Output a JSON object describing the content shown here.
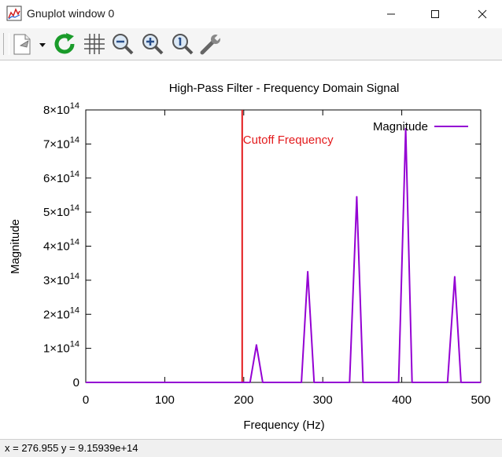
{
  "window": {
    "title": "Gnuplot window 0"
  },
  "toolbar": {
    "buttons": [
      {
        "name": "copy-export-icon"
      },
      {
        "name": "dropdown-arrow-icon"
      },
      {
        "name": "replot-icon"
      },
      {
        "name": "grid-icon"
      },
      {
        "name": "zoom-out-icon"
      },
      {
        "name": "zoom-in-icon"
      },
      {
        "name": "zoom-reset-icon"
      },
      {
        "name": "options-wrench-icon"
      }
    ]
  },
  "status": {
    "text": "x = 276.955 y = 9.15939e+14"
  },
  "colors": {
    "series": "#9400d3",
    "cutoff": "#e31a1c",
    "replot": "#1a9b2a"
  },
  "chart_data": {
    "type": "line",
    "title": "High-Pass Filter - Frequency Domain Signal",
    "xlabel": "Frequency (Hz)",
    "ylabel": "Magnitude",
    "xlim": [
      0,
      500
    ],
    "ylim": [
      0,
      800000000000000.0
    ],
    "x_ticks": [
      "0",
      "100",
      "200",
      "300",
      "400",
      "500"
    ],
    "y_ticks": [
      "0",
      "1×10^14",
      "2×10^14",
      "3×10^14",
      "4×10^14",
      "5×10^14",
      "6×10^14",
      "7×10^14",
      "8×10^14"
    ],
    "legend_position": "top-right",
    "series": [
      {
        "name": "Magnitude",
        "x": [
          0,
          208,
          216,
          224,
          273,
          281,
          289,
          334,
          343,
          351,
          396,
          405,
          413,
          458,
          467,
          475,
          500
        ],
        "y": [
          0,
          0,
          110000000000000.0,
          0,
          0,
          325000000000000.0,
          0,
          0,
          545000000000000.0,
          0,
          0,
          745000000000000.0,
          0,
          0,
          310000000000000.0,
          0,
          0
        ]
      }
    ],
    "annotations": [
      {
        "type": "vline",
        "x": 198,
        "label": "Cutoff Frequency"
      }
    ]
  }
}
